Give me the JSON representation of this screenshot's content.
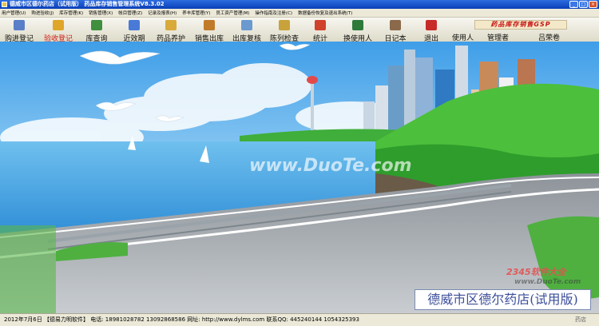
{
  "window": {
    "title": "德威市区德尔药店（试用版）  药品库存销售管理系统V8.3.02"
  },
  "menu": [
    "用户管理(U)",
    "购进验收(J)",
    "库存管理(K)",
    "销售管理(X)",
    "帐目管理(Z)",
    "记录及报表(H)",
    "养丰库管理(Y)",
    "员工资产管理(M)",
    "操作指南及注册(C)",
    "数据备份恢复及退出系统(T)"
  ],
  "toolbar": {
    "buttons": [
      {
        "label": "购进登记",
        "icon": "receipt-icon",
        "color": "#5a7fc8"
      },
      {
        "label": "验收登记",
        "icon": "check-pen-icon",
        "color": "#e0a62a"
      },
      {
        "label": "库查询",
        "icon": "magnifier-icon",
        "color": "#3f8f3f"
      },
      {
        "label": "近效期",
        "icon": "clock-icon",
        "color": "#4a7ad8"
      },
      {
        "label": "药品养护",
        "icon": "pill-care-icon",
        "color": "#d9a93a"
      },
      {
        "label": "销售出库",
        "icon": "cart-icon",
        "color": "#c07a2a"
      },
      {
        "label": "出库复核",
        "icon": "checklist-icon",
        "color": "#6a9ad0"
      },
      {
        "label": "陈列检查",
        "icon": "shelf-icon",
        "color": "#c8a23a"
      },
      {
        "label": "统计",
        "icon": "bar-chart-icon",
        "color": "#d0422a"
      },
      {
        "label": "换使用人",
        "icon": "user-switch-icon",
        "color": "#2f7a3a"
      },
      {
        "label": "日记本",
        "icon": "notebook-icon",
        "color": "#8a6a4a"
      },
      {
        "label": "退出",
        "icon": "exit-door-icon",
        "color": "#c82a2a"
      }
    ],
    "user_label": "使用人",
    "admin_label": "管理者",
    "admin_name": "吕荣卷"
  },
  "gsp_banner": "药品库存销售GSP",
  "watermarks": {
    "duote_center": "www.DuoTe.com",
    "logo_2345": "2345软件大全",
    "duote_url": "www.DuoTe.com",
    "stamp_tail": "药店"
  },
  "stamp_text": "德威市区德尔药店(试用版)",
  "footer": {
    "date": "2012年7月6日",
    "vendor": "【德易力明软件】",
    "phone_label": "电话:",
    "phone1": "18981028782",
    "phone2": "13092868586",
    "site_label": "网址:",
    "site": "http://www.dylms.com",
    "qq_label": "联系QQ:",
    "qq1": "445240144",
    "qq2": "1054325393"
  },
  "colors": {
    "titlebar": "#0a3fb8",
    "toolbar_highlight": "#d0201a",
    "stamp_text": "#3c4e9a"
  }
}
